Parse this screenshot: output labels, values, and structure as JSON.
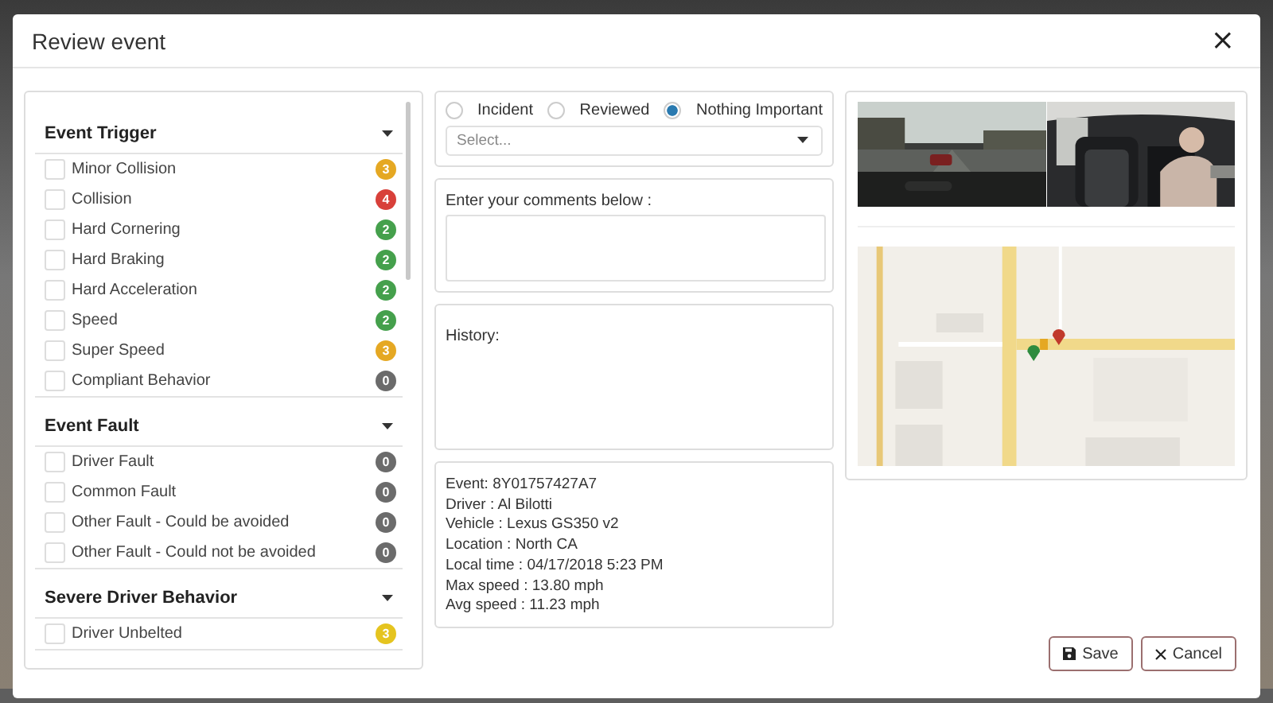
{
  "dialog": {
    "title": "Review event",
    "close": "×"
  },
  "filters": [
    {
      "title": "Event Trigger",
      "expanded": true,
      "items": [
        {
          "label": "Minor Collision",
          "checked": false,
          "count": "3",
          "color": "#e5a823"
        },
        {
          "label": "Collision",
          "checked": false,
          "count": "4",
          "color": "#d8403a"
        },
        {
          "label": "Hard Cornering",
          "checked": false,
          "count": "2",
          "color": "#45a04c"
        },
        {
          "label": "Hard Braking",
          "checked": false,
          "count": "2",
          "color": "#45a04c"
        },
        {
          "label": "Hard Acceleration",
          "checked": false,
          "count": "2",
          "color": "#45a04c"
        },
        {
          "label": "Speed",
          "checked": false,
          "count": "2",
          "color": "#45a04c"
        },
        {
          "label": "Super Speed",
          "checked": false,
          "count": "3",
          "color": "#e5a823"
        },
        {
          "label": "Compliant Behavior",
          "checked": false,
          "count": "0",
          "color": "#6b6b6b"
        }
      ]
    },
    {
      "title": "Event Fault",
      "expanded": true,
      "items": [
        {
          "label": "Driver Fault",
          "checked": false,
          "count": "0",
          "color": "#6b6b6b"
        },
        {
          "label": "Common Fault",
          "checked": false,
          "count": "0",
          "color": "#6b6b6b"
        },
        {
          "label": "Other Fault - Could be avoided",
          "checked": false,
          "count": "0",
          "color": "#6b6b6b"
        },
        {
          "label": "Other Fault - Could not be avoided",
          "checked": false,
          "count": "0",
          "color": "#6b6b6b"
        }
      ]
    },
    {
      "title": "Severe Driver Behavior",
      "expanded": true,
      "items": [
        {
          "label": "Driver Unbelted",
          "checked": false,
          "count": "3",
          "color": "#e5c41f"
        }
      ]
    }
  ],
  "review": {
    "options": [
      {
        "label": "Incident",
        "selected": false
      },
      {
        "label": "Reviewed",
        "selected": false
      },
      {
        "label": "Nothing Important",
        "selected": true
      }
    ],
    "select": {
      "placeholder": "Select..."
    }
  },
  "comments": {
    "label": "Enter your comments below :"
  },
  "history": {
    "label": "History:"
  },
  "details": [
    "Event: 8Y01757427A7",
    "Driver : Al Bilotti",
    "Vehicle : Lexus GS350 v2",
    "Location : North CA",
    "Local time : 04/17/2018 5:23 PM",
    "Max speed : 13.80 mph",
    "Avg speed : 11.23 mph"
  ],
  "buttons": [
    {
      "label": "Save",
      "kind": "save"
    },
    {
      "label": "Cancel",
      "kind": "cancel"
    }
  ]
}
